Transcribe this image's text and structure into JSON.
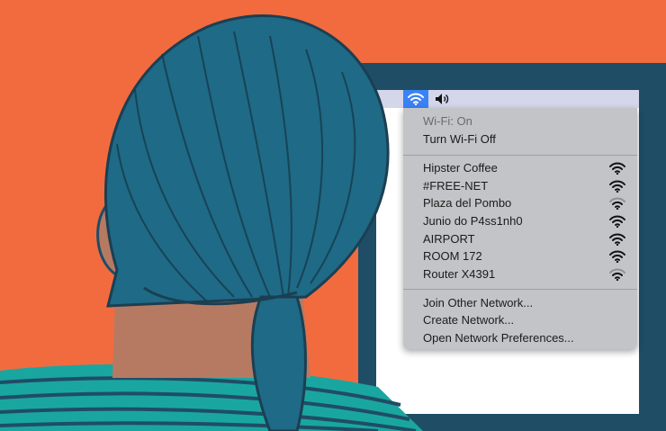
{
  "menubar": {
    "wifi_icon": "wifi-icon",
    "volume_icon": "volume-icon",
    "accent": "#3b82f6"
  },
  "wifi_menu": {
    "status": "Wi-Fi: On",
    "toggle_label": "Turn Wi-Fi Off",
    "networks": [
      {
        "name": "Hipster Coffee",
        "strength": 1.0
      },
      {
        "name": "#FREE-NET",
        "strength": 1.0
      },
      {
        "name": "Plaza del Pombo",
        "strength": 0.67
      },
      {
        "name": "Junio do P4ss1nh0",
        "strength": 1.0
      },
      {
        "name": "AIRPORT",
        "strength": 1.0
      },
      {
        "name": "ROOM 172",
        "strength": 1.0
      },
      {
        "name": "Router X4391",
        "strength": 0.67
      }
    ],
    "join_other": "Join Other Network...",
    "create_network": "Create Network...",
    "open_prefs": "Open Network Preferences..."
  },
  "colors": {
    "background": "#f26b3f",
    "monitor": "#1f4d66",
    "hair": "#1f6a86",
    "skin": "#b67a63",
    "shirt": "#1aa6a0"
  }
}
